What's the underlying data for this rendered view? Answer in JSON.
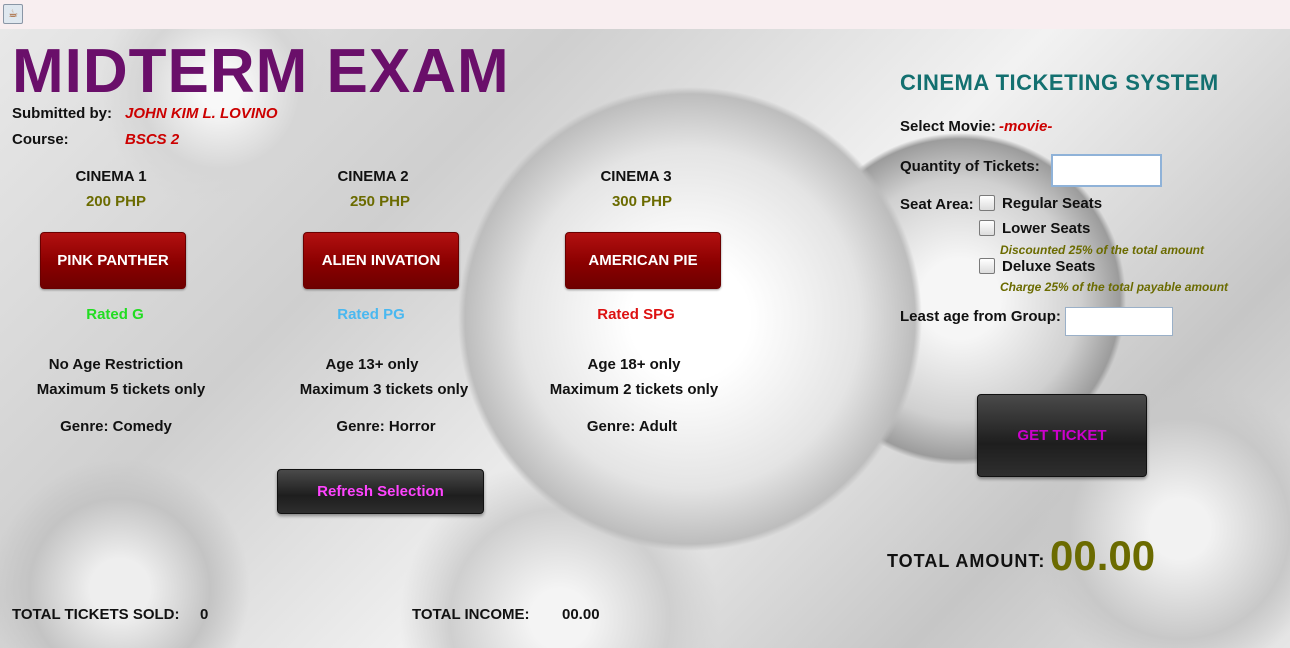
{
  "header": {
    "title": "MIDTERM EXAM"
  },
  "submission": {
    "submitted_by_label": "Submitted by:",
    "submitted_by_value": "JOHN KIM L. LOVINO",
    "course_label": "Course:",
    "course_value": "BSCS 2"
  },
  "cinemas": [
    {
      "name": "CINEMA 1",
      "price": "200 PHP",
      "movie": "PINK PANTHER",
      "rating": "Rated G",
      "rating_color": "#22dd22",
      "age": "No Age Restriction",
      "max": "Maximum 5 tickets only",
      "genre": "Genre: Comedy"
    },
    {
      "name": "CINEMA 2",
      "price": "250 PHP",
      "movie": "ALIEN INVATION",
      "rating": "Rated  PG",
      "rating_color": "#4ab8f0",
      "age": "Age 13+ only",
      "max": "Maximum 3 tickets only",
      "genre": "Genre: Horror"
    },
    {
      "name": "CINEMA 3",
      "price": "300 PHP",
      "movie": "AMERICAN PIE",
      "rating": "Rated SPG",
      "rating_color": "#dd1111",
      "age": "Age 18+ only",
      "max": "Maximum 2 tickets only",
      "genre": "Genre: Adult"
    }
  ],
  "refresh_button": "Refresh Selection",
  "system": {
    "title": "CINEMA TICKETING SYSTEM",
    "select_movie_label": "Select Movie:",
    "select_movie_value": "-movie-",
    "quantity_label": "Quantity of Tickets:",
    "quantity_value": "",
    "seat_area_label": "Seat Area:",
    "seats": [
      {
        "label": "Regular Seats",
        "checked": false
      },
      {
        "label": "Lower Seats",
        "checked": false,
        "note": "Discounted 25% of the total amount"
      },
      {
        "label": "Deluxe Seats",
        "checked": false,
        "note": "Charge 25% of the total payable amount"
      }
    ],
    "least_age_label": "Least age from Group:",
    "least_age_value": "",
    "get_ticket_button": "GET TICKET",
    "total_amount_label": "TOTAL AMOUNT:",
    "total_amount_value": "00.00"
  },
  "footer": {
    "tickets_sold_label": "TOTAL TICKETS SOLD:",
    "tickets_sold_value": "0",
    "income_label": "TOTAL INCOME:",
    "income_value": "00.00"
  },
  "colors": {
    "title": "#6a0f6a",
    "movie_button": "#8a0000",
    "system_title": "#137070",
    "refresh_text": "#ff44ff",
    "get_ticket_text": "#cc00cc",
    "total_value": "#6b6b00"
  },
  "icons": {
    "app_icon": "java-coffee-cup-icon"
  }
}
